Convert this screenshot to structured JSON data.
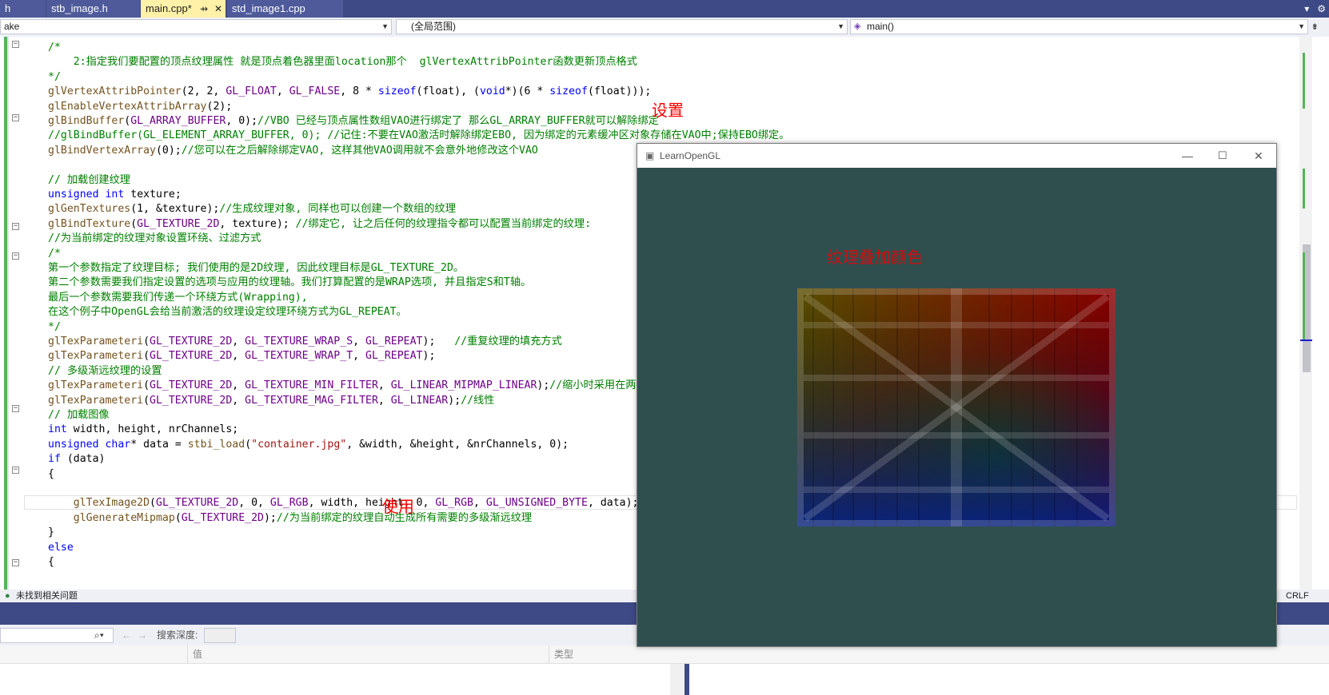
{
  "tabs": {
    "partial": "h",
    "items": [
      {
        "label": "stb_image.h",
        "active": false
      },
      {
        "label": "main.cpp*",
        "active": true
      },
      {
        "label": "std_image1.cpp",
        "active": false
      }
    ]
  },
  "navbar": {
    "project": "ake",
    "scope": "(全局范围)",
    "member": "main()"
  },
  "code_lines": [
    "/*",
    "    2:指定我们要配置的顶点纹理属性 就是顶点着色器里面location那个  glVertexAttribPointer函数更新顶点格式",
    "*/",
    "glVertexAttribPointer(2, 2, GL_FLOAT, GL_FALSE, 8 * sizeof(float), (void*)(6 * sizeof(float)));",
    "glEnableVertexAttribArray(2);",
    "glBindBuffer(GL_ARRAY_BUFFER, 0);//VBO 已经与顶点属性数组VAO进行绑定了 那么GL_ARRAY_BUFFER就可以解除绑定",
    "//glBindBuffer(GL_ELEMENT_ARRAY_BUFFER, 0); //记住:不要在VAO激活时解除绑定EBO, 因为绑定的元素缓冲区对象存储在VAO中;保持EBO绑定。",
    "glBindVertexArray(0);//您可以在之后解除绑定VAO, 这样其他VAO调用就不会意外地修改这个VAO",
    "",
    "// 加载创建纹理",
    "unsigned int texture;",
    "glGenTextures(1, &texture);//生成纹理对象, 同样也可以创建一个数组的纹理",
    "glBindTexture(GL_TEXTURE_2D, texture); //绑定它, 让之后任何的纹理指令都可以配置当前绑定的纹理:",
    "//为当前绑定的纹理对象设置环绕、过滤方式",
    "/*",
    "第一个参数指定了纹理目标; 我们使用的是2D纹理, 因此纹理目标是GL_TEXTURE_2D。",
    "第二个参数需要我们指定设置的选项与应用的纹理轴。我们打算配置的是WRAP选项, 并且指定S和T轴。",
    "最后一个参数需要我们传递一个环绕方式(Wrapping),",
    "在这个例子中OpenGL会给当前激活的纹理设定纹理环绕方式为GL_REPEAT。",
    "*/",
    "glTexParameteri(GL_TEXTURE_2D, GL_TEXTURE_WRAP_S, GL_REPEAT);   //重复纹理的填充方式",
    "glTexParameteri(GL_TEXTURE_2D, GL_TEXTURE_WRAP_T, GL_REPEAT);",
    "// 多级渐远纹理的设置",
    "glTexParameteri(GL_TEXTURE_2D, GL_TEXTURE_MIN_FILTER, GL_LINEAR_MIPMAP_LINEAR);//缩小时采用在两",
    "glTexParameteri(GL_TEXTURE_2D, GL_TEXTURE_MAG_FILTER, GL_LINEAR);//线性",
    "// 加载图像",
    "int width, height, nrChannels;",
    "unsigned char* data = stbi_load(\"container.jpg\", &width, &height, &nrChannels, 0);",
    "if (data)",
    "{",
    "",
    "    glTexImage2D(GL_TEXTURE_2D, 0, GL_RGB, width, height, 0, GL_RGB, GL_UNSIGNED_BYTE, data);",
    "    glGenerateMipmap(GL_TEXTURE_2D);//为当前绑定的纹理自动生成所有需要的多级渐远纹理",
    "}",
    "else",
    "{"
  ],
  "annotations": {
    "set": "设置",
    "use": "使用",
    "texture_color": "纹理叠加颜色"
  },
  "status": {
    "issues": "未找到相关问题",
    "eol": "CRLF"
  },
  "panel": {
    "search_depth_label": "搜索深度:",
    "col_value": "值",
    "col_type": "类型"
  },
  "glwindow": {
    "title": "LearnOpenGL",
    "bg_color": "#2f4f4f"
  }
}
